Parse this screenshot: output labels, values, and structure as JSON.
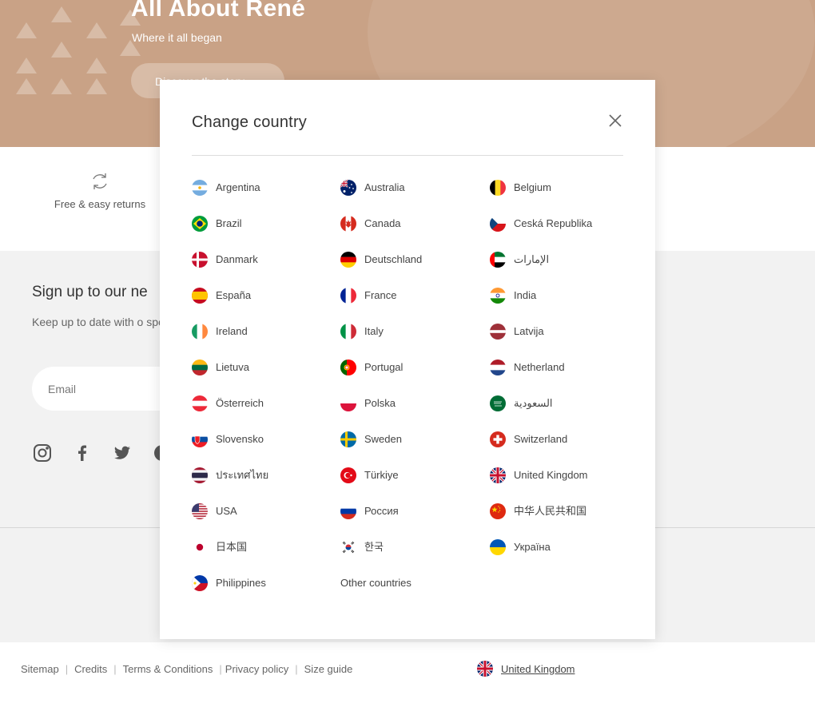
{
  "hero": {
    "title": "All About René",
    "subtitle": "Where it all began",
    "cta_label": "Discover the story"
  },
  "features": [
    {
      "icon": "refresh-icon",
      "label": "Free & easy returns"
    }
  ],
  "newsletter": {
    "title": "Sign up to our ne",
    "description": "Keep up to date with o special offers",
    "email_placeholder": "Email"
  },
  "social_icons": [
    "instagram-icon",
    "facebook-icon",
    "twitter-icon",
    "pinterest-icon"
  ],
  "footer": {
    "links": [
      "Sitemap",
      "Credits",
      "Terms & Conditions",
      "Privacy policy",
      "Size guide"
    ],
    "current_country": "United Kingdom"
  },
  "modal": {
    "title": "Change country",
    "close_icon": "close-icon",
    "countries": [
      {
        "label": "Argentina",
        "flag": "ar"
      },
      {
        "label": "Australia",
        "flag": "au"
      },
      {
        "label": "Belgium",
        "flag": "be"
      },
      {
        "label": "Brazil",
        "flag": "br"
      },
      {
        "label": "Canada",
        "flag": "ca"
      },
      {
        "label": "Ceská Republika",
        "flag": "cz"
      },
      {
        "label": "Danmark",
        "flag": "dk"
      },
      {
        "label": "Deutschland",
        "flag": "de"
      },
      {
        "label": "الإمارات",
        "flag": "ae"
      },
      {
        "label": "España",
        "flag": "es"
      },
      {
        "label": "France",
        "flag": "fr"
      },
      {
        "label": "India",
        "flag": "in"
      },
      {
        "label": "Ireland",
        "flag": "ie"
      },
      {
        "label": "Italy",
        "flag": "it"
      },
      {
        "label": "Latvija",
        "flag": "lv"
      },
      {
        "label": "Lietuva",
        "flag": "lt"
      },
      {
        "label": "Portugal",
        "flag": "pt"
      },
      {
        "label": "Netherland",
        "flag": "nl"
      },
      {
        "label": "Österreich",
        "flag": "at"
      },
      {
        "label": "Polska",
        "flag": "pl"
      },
      {
        "label": "السعودية",
        "flag": "sa"
      },
      {
        "label": "Slovensko",
        "flag": "sk"
      },
      {
        "label": "Sweden",
        "flag": "se"
      },
      {
        "label": "Switzerland",
        "flag": "ch"
      },
      {
        "label": "ประเทศไทย",
        "flag": "th"
      },
      {
        "label": "Türkiye",
        "flag": "tr"
      },
      {
        "label": "United Kingdom",
        "flag": "gb"
      },
      {
        "label": "USA",
        "flag": "us"
      },
      {
        "label": "Россия",
        "flag": "ru"
      },
      {
        "label": "中华人民共和国",
        "flag": "cn"
      },
      {
        "label": "日本国",
        "flag": "jp"
      },
      {
        "label": "한국",
        "flag": "kr"
      },
      {
        "label": "Україна",
        "flag": "ua"
      },
      {
        "label": "Philippines",
        "flag": "ph"
      },
      {
        "label": "Other countries",
        "flag": ""
      }
    ]
  },
  "colors": {
    "hero_bg": "#c9a286",
    "footer_bg": "#f2f2f2",
    "text": "#333333"
  }
}
